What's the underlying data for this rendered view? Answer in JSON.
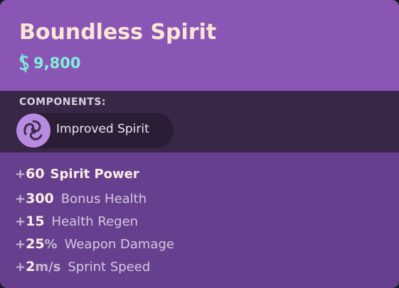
{
  "item": {
    "title": "Boundless Spirit",
    "price": "9,800",
    "price_icon": "souls-currency-icon"
  },
  "components": {
    "heading": "COMPONENTS:",
    "items": [
      {
        "label": "Improved Spirit",
        "icon": "spirit-swirl-icon"
      }
    ]
  },
  "stats": [
    {
      "plus": "+",
      "value": "60",
      "unit": "",
      "label": "Spirit Power"
    },
    {
      "plus": "+",
      "value": "300",
      "unit": "",
      "label": "Bonus Health"
    },
    {
      "plus": "+",
      "value": "15",
      "unit": "",
      "label": "Health Regen"
    },
    {
      "plus": "+",
      "value": "25",
      "unit": "%",
      "label": "Weapon Damage"
    },
    {
      "plus": "+",
      "value": "2",
      "unit": "m/s",
      "label": "Sprint Speed"
    }
  ],
  "colors": {
    "header_bg": "#8a56b6",
    "components_bg": "#3a2748",
    "body_bg": "#663f8e",
    "price": "#7ff0d9",
    "title": "#fbe6d6"
  }
}
